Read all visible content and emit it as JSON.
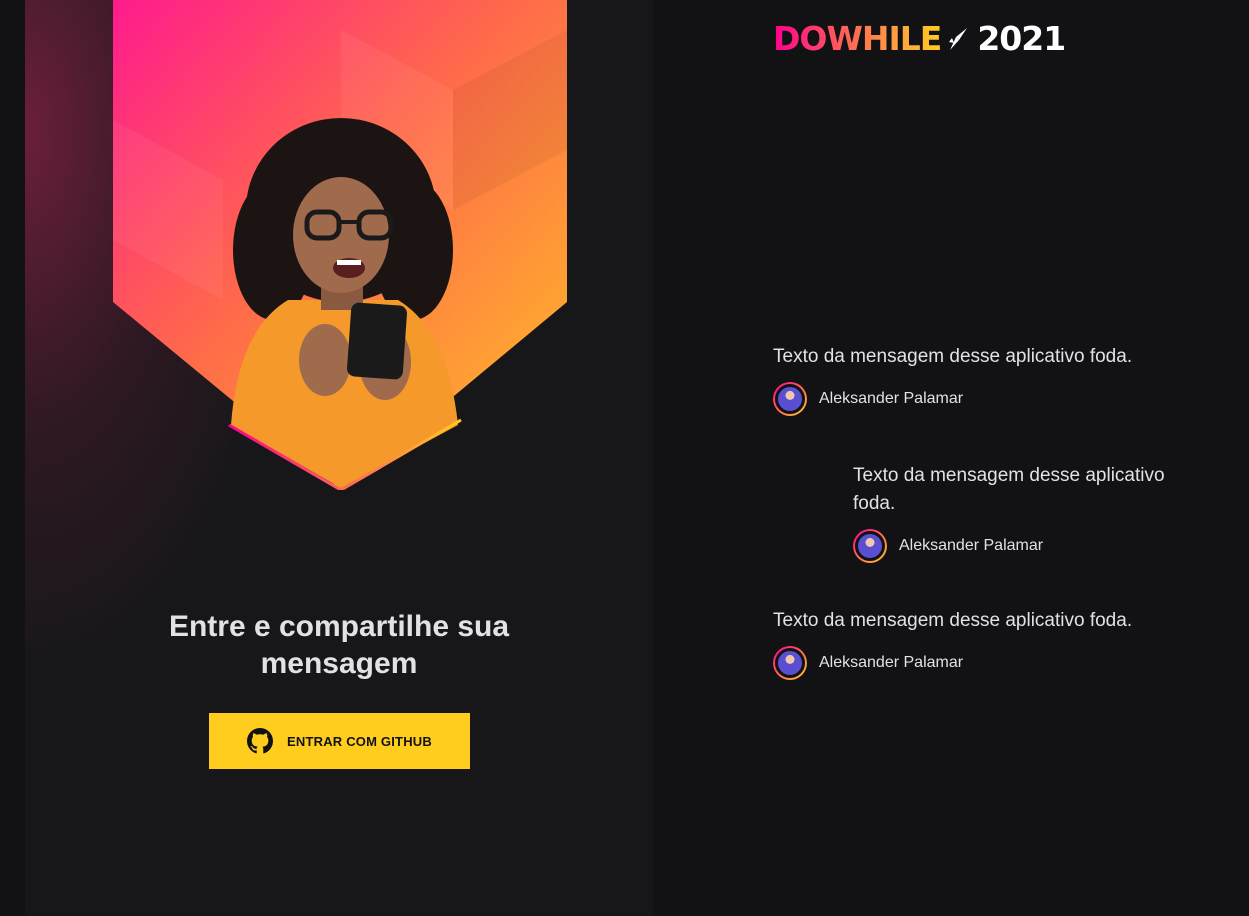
{
  "login": {
    "title": "Entre e compartilhe sua mensagem",
    "github_button_label": "ENTRAR COM GITHUB",
    "github_icon": "github-icon",
    "button_color": "#ffcd1e"
  },
  "logo": {
    "brand": "DOWHILE",
    "year": "2021",
    "icon": "rocket-icon"
  },
  "messages": [
    {
      "text": "Texto da mensagem desse aplicativo foda.",
      "user": "Aleksander Palamar"
    },
    {
      "text": "Texto da mensagem desse aplicativo foda.",
      "user": "Aleksander Palamar"
    },
    {
      "text": "Texto da mensagem desse aplicativo foda.",
      "user": "Aleksander Palamar"
    }
  ],
  "colors": {
    "background": "#121214",
    "panel": "#17171a",
    "accent_pink": "#ff008e",
    "accent_yellow": "#ffcd1e",
    "text": "#e1e1e6"
  }
}
